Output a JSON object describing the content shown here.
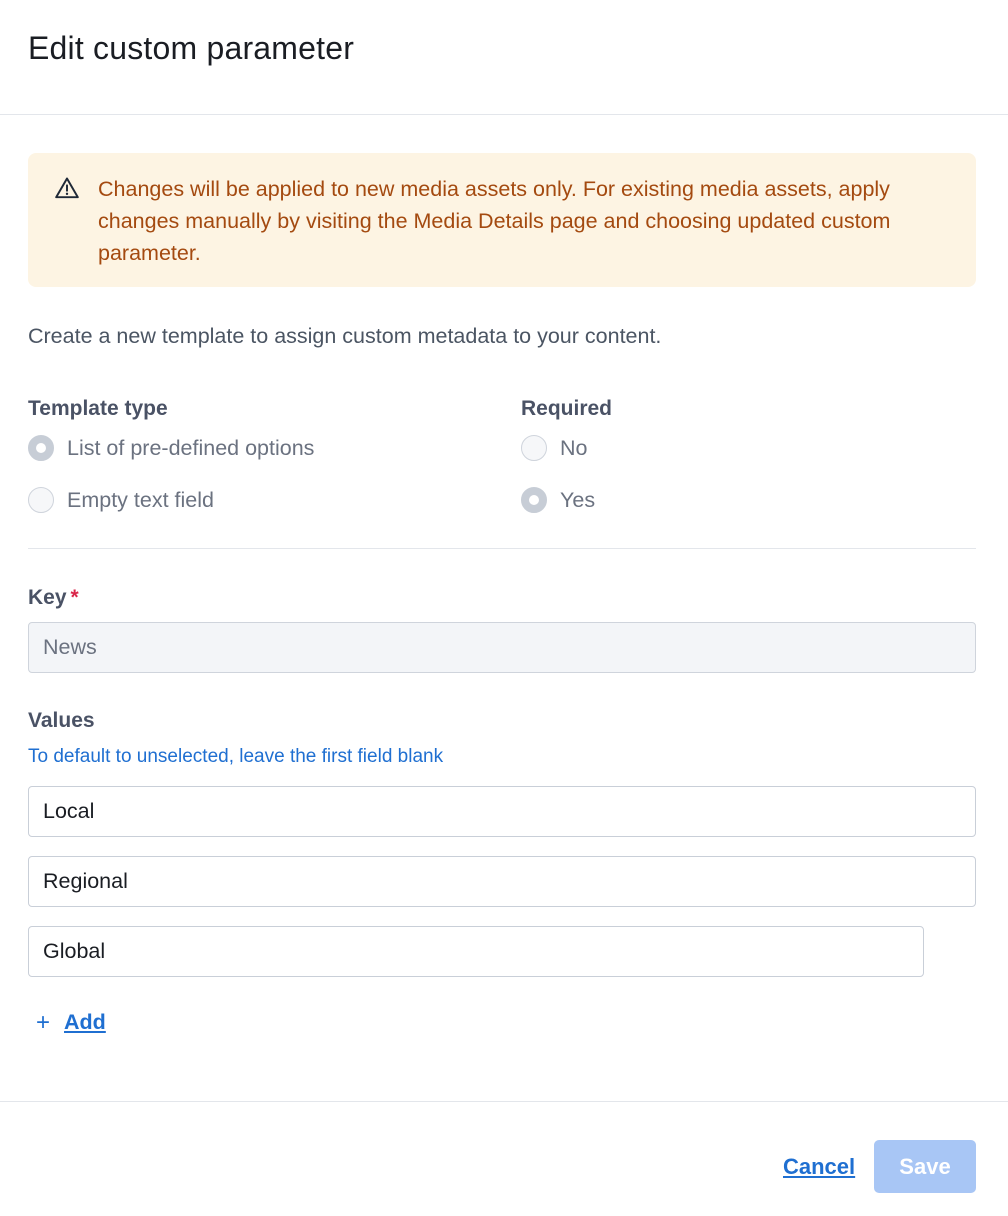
{
  "dialog": {
    "title": "Edit custom parameter"
  },
  "alert": {
    "icon": "warning-triangle-icon",
    "text": "Changes will be applied to new media assets only. For existing media assets, apply changes manually by visiting the Media Details page and choosing updated custom parameter."
  },
  "intro": "Create a new template to assign custom metadata to your content.",
  "template_type": {
    "label": "Template type",
    "options": [
      {
        "label": "List of pre-defined options",
        "checked": true
      },
      {
        "label": "Empty text field",
        "checked": false
      }
    ]
  },
  "required": {
    "label": "Required",
    "options": [
      {
        "label": "No",
        "checked": false
      },
      {
        "label": "Yes",
        "checked": true
      }
    ]
  },
  "key": {
    "label": "Key",
    "required_mark": "*",
    "value": "News"
  },
  "values": {
    "label": "Values",
    "hint": "To default to unselected, leave the first field blank",
    "items": [
      "Local",
      "Regional",
      "Global"
    ],
    "add_symbol": "+",
    "add_label": "Add"
  },
  "footer": {
    "cancel_label": "Cancel",
    "save_label": "Save"
  },
  "colors": {
    "alert_bg": "#fdf4e3",
    "alert_text": "#a44a10",
    "link": "#1f6fd1",
    "required": "#d9264a",
    "save_disabled": "#a8c6f5"
  }
}
